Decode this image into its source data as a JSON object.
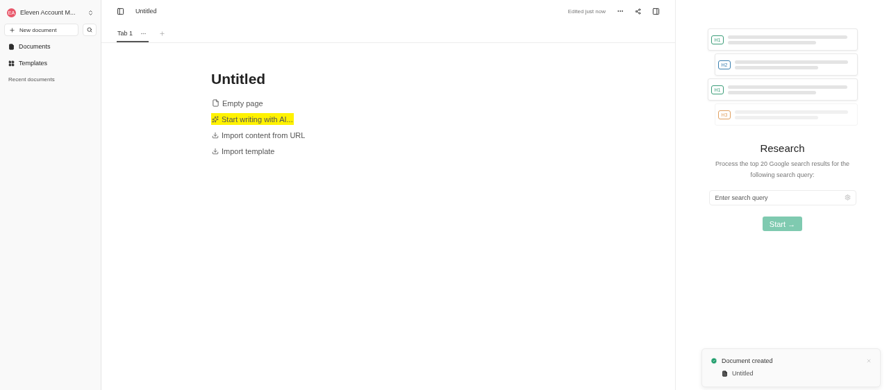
{
  "workspace": {
    "name": "Eleven Account M...",
    "initials": "EA"
  },
  "sidebar": {
    "new_button": "New document",
    "items": [
      {
        "label": "Documents",
        "kind": "documents"
      },
      {
        "label": "Templates",
        "kind": "templates"
      }
    ],
    "section": "Recent documents"
  },
  "header": {
    "title": "Untitled",
    "status": "Edited just now"
  },
  "tabs": [
    {
      "label": "Tab 1",
      "selected": true
    }
  ],
  "document": {
    "title": "Untitled",
    "options": [
      {
        "label": "Empty page",
        "kind": "file",
        "highlighted": false
      },
      {
        "label": "Start writing with AI...",
        "kind": "sparkle",
        "highlighted": true
      },
      {
        "label": "Import content from URL",
        "kind": "download",
        "highlighted": false
      },
      {
        "label": "Import template",
        "kind": "download",
        "highlighted": false
      }
    ]
  },
  "research": {
    "outline": [
      {
        "label": "H1",
        "color": "#3a9d78",
        "faded": false
      },
      {
        "label": "H2",
        "color": "#3a7fb0",
        "faded": false
      },
      {
        "label": "H1",
        "color": "#3a9d78",
        "faded": false
      },
      {
        "label": "H3",
        "color": "#e0a060",
        "faded": true
      }
    ],
    "title": "Research",
    "description": "Process the top 20 Google search results for the following search query:",
    "placeholder": "Enter search query",
    "button": "Start →"
  },
  "toast": {
    "title": "Document created",
    "item": "Untitled"
  }
}
